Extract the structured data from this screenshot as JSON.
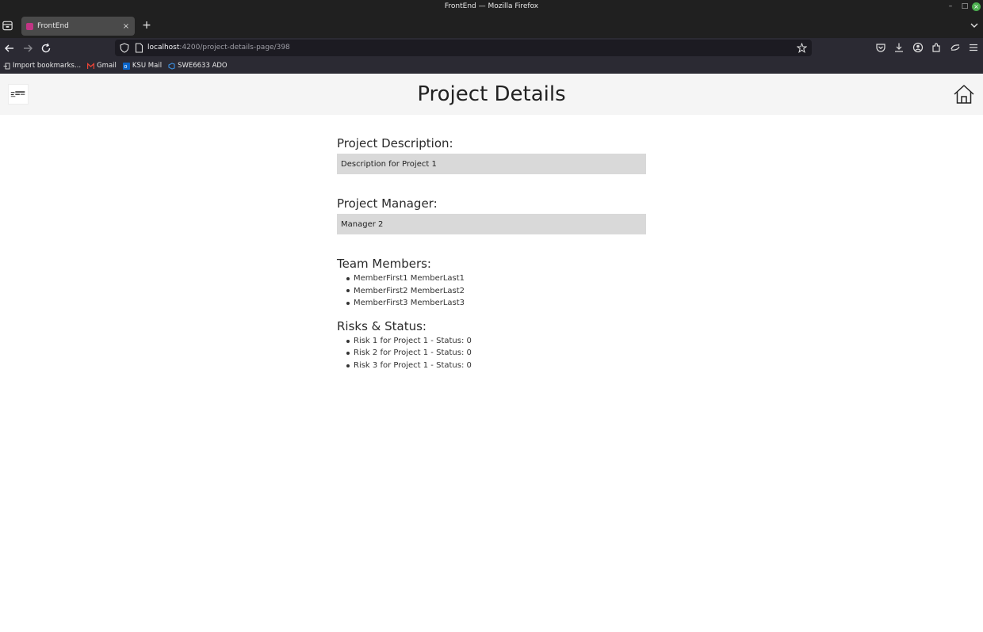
{
  "window": {
    "title": "FrontEnd — Mozilla Firefox"
  },
  "tabs": [
    {
      "title": "FrontEnd",
      "active": true
    }
  ],
  "nav": {
    "url_host": "localhost",
    "url_rest": ":4200/project-details-page/398"
  },
  "bookmarks": [
    {
      "label": "Import bookmarks...",
      "icon": "import-icon"
    },
    {
      "label": "Gmail",
      "icon": "gmail-icon"
    },
    {
      "label": "KSU Mail",
      "icon": "outlook-icon"
    },
    {
      "label": "SWE6633 ADO",
      "icon": "azure-devops-icon"
    }
  ],
  "header": {
    "title": "Project Details",
    "home_icon": "home-icon",
    "logo_icon": "app-logo"
  },
  "project": {
    "description_label": "Project Description:",
    "description_value": "Description for Project 1",
    "manager_label": "Project Manager:",
    "manager_value": "Manager 2",
    "team_label": "Team Members:",
    "team_members": [
      "MemberFirst1 MemberLast1",
      "MemberFirst2 MemberLast2",
      "MemberFirst3 MemberLast3"
    ],
    "risks_label": "Risks & Status:",
    "risks": [
      "Risk 1 for Project 1 - Status: 0",
      "Risk 2 for Project 1 - Status: 0",
      "Risk 3 for Project 1 - Status: 0"
    ]
  },
  "colors": {
    "chrome_dark": "#202020",
    "toolbar": "#2b2a33",
    "header_bg": "#f5f5f5",
    "field_bg": "#d9d9d9"
  }
}
